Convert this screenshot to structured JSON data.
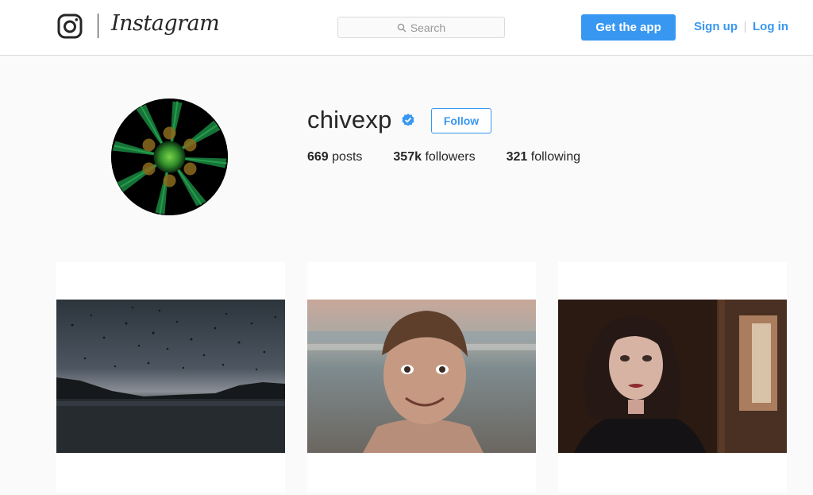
{
  "nav": {
    "wordmark": "Instagram",
    "search_placeholder": "Search",
    "get_app_label": "Get the app",
    "sign_up_label": "Sign up",
    "log_in_label": "Log in",
    "accent_color": "#3897f0"
  },
  "profile": {
    "username": "chivexp",
    "verified": true,
    "follow_label": "Follow",
    "stats": {
      "posts_count": "669",
      "posts_label": "posts",
      "followers_count": "357k",
      "followers_label": "followers",
      "following_count": "321",
      "following_label": "following"
    }
  },
  "posts": [
    {
      "subject": "birds over lake at dusk"
    },
    {
      "subject": "boy smiling on beach"
    },
    {
      "subject": "woman portrait in dark room"
    }
  ]
}
